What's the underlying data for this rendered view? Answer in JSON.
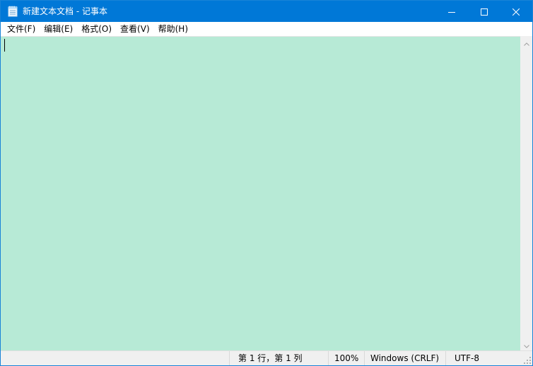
{
  "window": {
    "title": "新建文本文档 - 记事本",
    "accent_color": "#0078d7",
    "icons": {
      "app": "notepad-icon",
      "minimize": "minimize-icon",
      "maximize": "maximize-icon",
      "close": "close-icon"
    }
  },
  "menu": {
    "items": [
      {
        "label": "文件(F)"
      },
      {
        "label": "编辑(E)"
      },
      {
        "label": "格式(O)"
      },
      {
        "label": "查看(V)"
      },
      {
        "label": "帮助(H)"
      }
    ]
  },
  "editor": {
    "text": "",
    "background_color": "#b7ead6"
  },
  "statusbar": {
    "position": "第 1 行，第 1 列",
    "zoom": "100%",
    "line_ending": "Windows (CRLF)",
    "encoding": "UTF-8"
  }
}
